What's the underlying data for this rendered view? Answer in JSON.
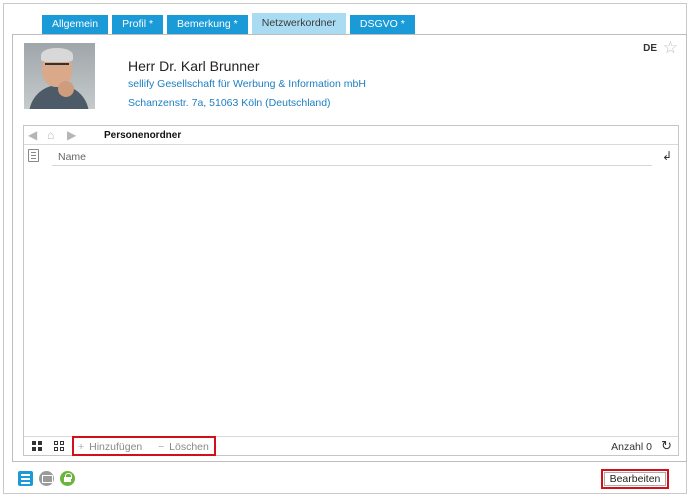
{
  "tabs": [
    {
      "label": "Allgemein",
      "active": false
    },
    {
      "label": "Profil *",
      "active": false
    },
    {
      "label": "Bemerkung *",
      "active": false
    },
    {
      "label": "Netzwerkordner",
      "active": true
    },
    {
      "label": "DSGVO *",
      "active": false
    }
  ],
  "contact": {
    "name": "Herr Dr. Karl Brunner",
    "company": "sellify Gesellschaft für Werbung & Information mbH",
    "address": "Schanzenstr. 7a, 51063 Köln (Deutschland)",
    "language": "DE"
  },
  "folder": {
    "title": "Personenordner",
    "column_name": "Name",
    "add_label": "Hinzufügen",
    "delete_label": "Löschen",
    "count_label": "Anzahl 0"
  },
  "bottom": {
    "edit_label": "Bearbeiten"
  },
  "colors": {
    "tab": "#1b9ad8",
    "tab_active": "#a9dcf3",
    "link": "#1b7fc0",
    "highlight": "#d0111b"
  }
}
